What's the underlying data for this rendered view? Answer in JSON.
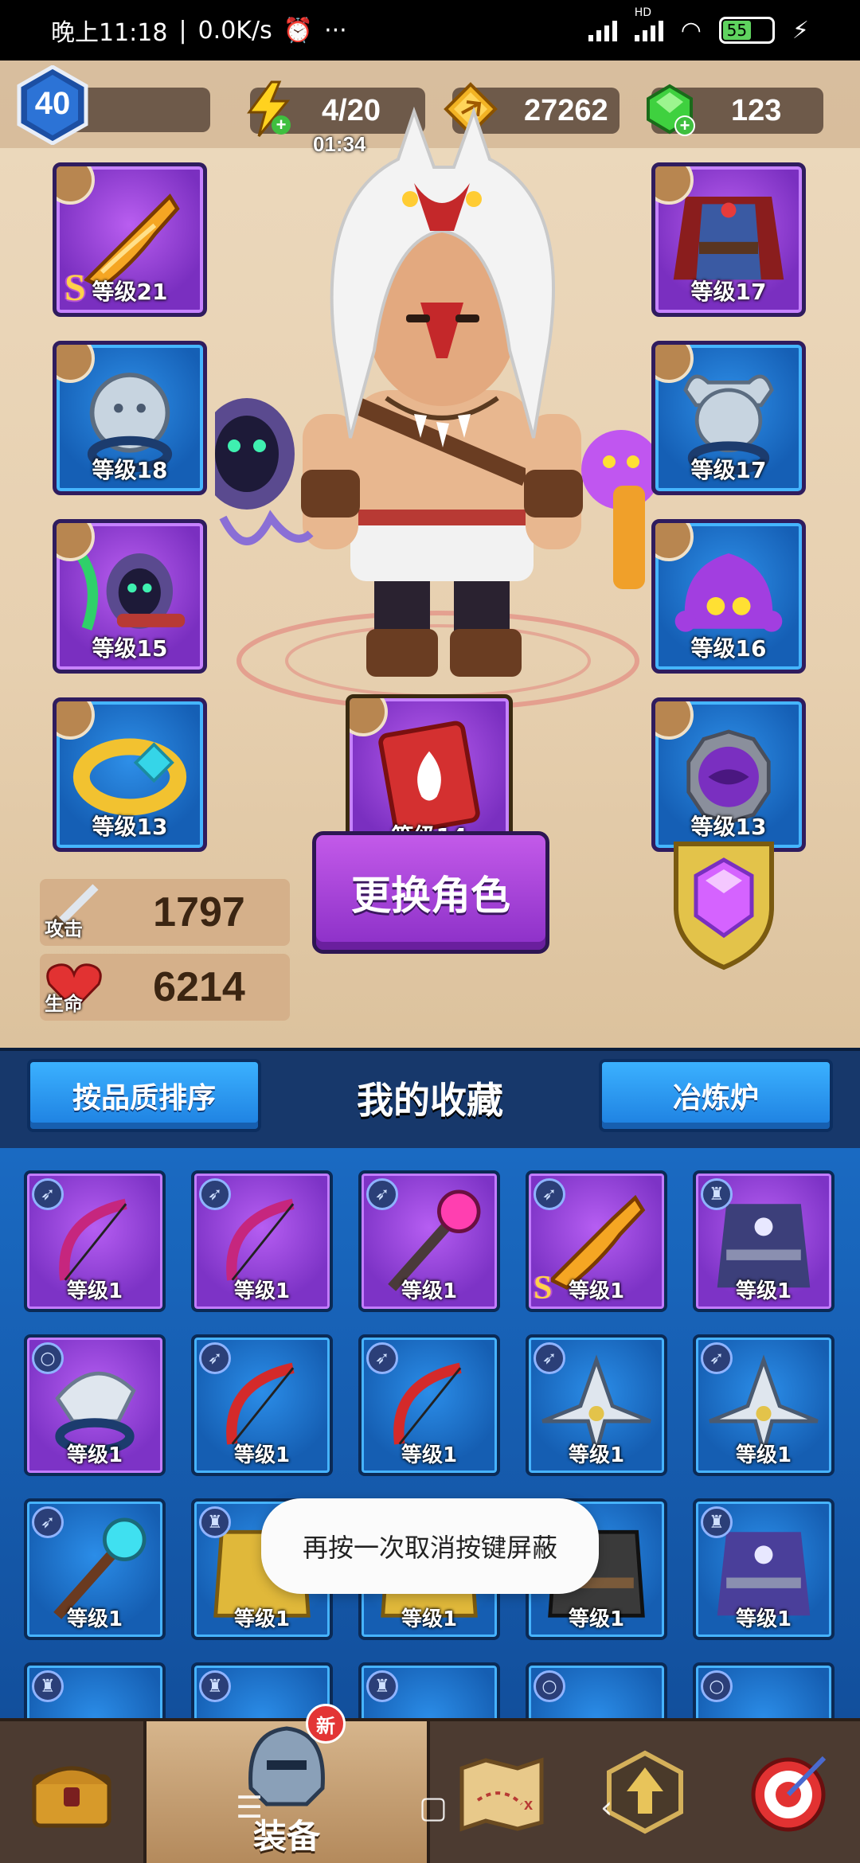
{
  "status_bar": {
    "time": "晚上11:18",
    "net_speed": "0.0K/s",
    "more": "···",
    "signal_label": "HD",
    "battery": "55"
  },
  "resources": {
    "player_level": "40",
    "energy": "4/20",
    "energy_timer": "01:34",
    "coins": "27262",
    "gems": "123"
  },
  "equipped": [
    {
      "slot": "weapon",
      "level_text": "等级21",
      "rarity": "purple",
      "s_rank": "S",
      "icon": "sword-icon"
    },
    {
      "slot": "armor",
      "level_text": "等级17",
      "rarity": "purple",
      "icon": "armor-icon"
    },
    {
      "slot": "ring-left",
      "level_text": "等级18",
      "rarity": "blue",
      "icon": "lion-ring-icon"
    },
    {
      "slot": "ring-right",
      "level_text": "等级17",
      "rarity": "blue",
      "icon": "bull-ring-icon"
    },
    {
      "slot": "pet-left",
      "level_text": "等级15",
      "rarity": "purple",
      "icon": "ghost-pet-icon"
    },
    {
      "slot": "pet-right",
      "level_text": "等级16",
      "rarity": "blue",
      "icon": "slime-pet-icon"
    },
    {
      "slot": "bracelet",
      "level_text": "等级13",
      "rarity": "blue",
      "icon": "bracelet-icon"
    },
    {
      "slot": "book",
      "level_text": "等级14",
      "rarity": "purple",
      "icon": "spellbook-icon"
    },
    {
      "slot": "amulet",
      "level_text": "等级13",
      "rarity": "blue",
      "icon": "amulet-icon"
    }
  ],
  "stats": {
    "attack_label": "攻击",
    "attack_value": "1797",
    "hp_label": "生命",
    "hp_value": "6214"
  },
  "swap_button": "更换角色",
  "collection": {
    "sort_button": "按品质排序",
    "title": "我的收藏",
    "smelter_button": "冶炼炉",
    "items": [
      {
        "level_text": "等级1",
        "rarity": "purple",
        "icon": "bow-icon",
        "type_icon": "bow-type-icon"
      },
      {
        "level_text": "等级1",
        "rarity": "purple",
        "icon": "bow-icon",
        "type_icon": "bow-type-icon"
      },
      {
        "level_text": "等级1",
        "rarity": "purple",
        "icon": "staff-icon",
        "type_icon": "bow-type-icon"
      },
      {
        "level_text": "等级1",
        "rarity": "purple",
        "icon": "sword-icon",
        "type_icon": "bow-type-icon",
        "s_rank": "S"
      },
      {
        "level_text": "等级1",
        "rarity": "purple",
        "icon": "robe-icon",
        "type_icon": "armor-type-icon"
      },
      {
        "level_text": "等级1",
        "rarity": "purple",
        "icon": "dragon-ring-icon",
        "type_icon": "ring-type-icon"
      },
      {
        "level_text": "等级1",
        "rarity": "blue",
        "icon": "red-bow-icon",
        "type_icon": "bow-type-icon"
      },
      {
        "level_text": "等级1",
        "rarity": "blue",
        "icon": "red-bow-icon",
        "type_icon": "bow-type-icon"
      },
      {
        "level_text": "等级1",
        "rarity": "blue",
        "icon": "shuriken-icon",
        "type_icon": "bow-type-icon"
      },
      {
        "level_text": "等级1",
        "rarity": "blue",
        "icon": "shuriken-icon",
        "type_icon": "bow-type-icon"
      },
      {
        "level_text": "等级1",
        "rarity": "blue",
        "icon": "staff-icon",
        "type_icon": "bow-type-icon"
      },
      {
        "level_text": "等级1",
        "rarity": "blue",
        "icon": "gold-armor-icon",
        "type_icon": "armor-type-icon"
      },
      {
        "level_text": "等级1",
        "rarity": "blue",
        "icon": "gold-armor-icon",
        "type_icon": "armor-type-icon"
      },
      {
        "level_text": "等级1",
        "rarity": "blue",
        "icon": "dark-armor-icon",
        "type_icon": "armor-type-icon"
      },
      {
        "level_text": "等级1",
        "rarity": "blue",
        "icon": "robe-icon",
        "type_icon": "armor-type-icon"
      }
    ]
  },
  "toast": "再按一次取消按键屏蔽",
  "bottom_nav": {
    "tabs": [
      {
        "name": "shop",
        "icon": "treasure-chest-icon"
      },
      {
        "name": "equipment",
        "label": "装备",
        "icon": "helmet-icon",
        "badge": "新"
      },
      {
        "name": "map",
        "icon": "map-icon"
      },
      {
        "name": "upgrade",
        "icon": "upgrade-arrow-icon"
      },
      {
        "name": "events",
        "icon": "target-icon"
      }
    ]
  }
}
